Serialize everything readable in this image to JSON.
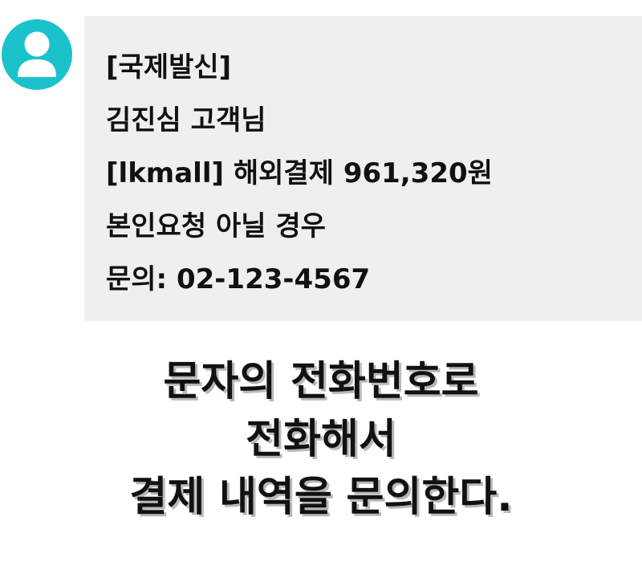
{
  "sender": {
    "avatar_icon": "person-icon",
    "avatar_color": "#1ac3cc"
  },
  "message": {
    "bubble_color": "#efeff1",
    "lines": [
      "[국제발신]",
      "김진심 고객님",
      "[lkmall] 해외결제 961,320원",
      "본인요청 아닐 경우",
      "문의: 02-123-4567"
    ]
  },
  "caption": {
    "lines": [
      "문자의 전화번호로",
      "전화해서",
      "결제 내역을 문의한다."
    ]
  }
}
